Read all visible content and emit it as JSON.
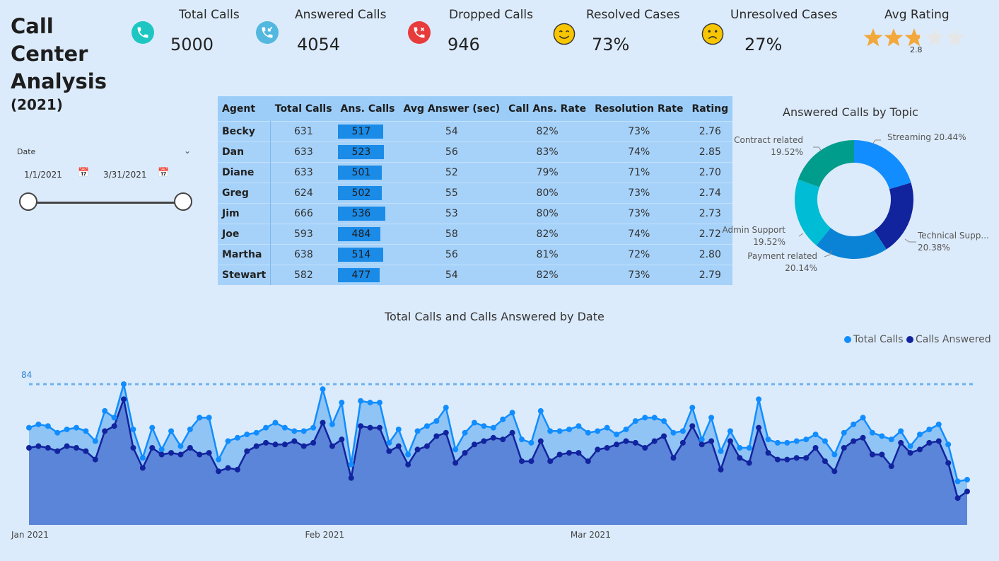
{
  "title": {
    "line1": "Call",
    "line2": "Center",
    "line3": "Analysis",
    "year": "(2021)"
  },
  "kpis": [
    {
      "label": "Total Calls",
      "value": "5000",
      "icon": "phone-icon",
      "color": "#1ec6c2"
    },
    {
      "label": "Answered Calls",
      "value": "4054",
      "icon": "incoming-call-icon",
      "color": "#52b8df"
    },
    {
      "label": "Dropped Calls",
      "value": "946",
      "icon": "missed-call-icon",
      "color": "#e83b3b"
    },
    {
      "label": "Resolved Cases",
      "value": "73%",
      "icon": "smiling-face-icon",
      "color": "#f7c600"
    },
    {
      "label": "Unresolved Cases",
      "value": "27%",
      "icon": "frowning-face-icon",
      "color": "#f7c600"
    }
  ],
  "avg_rating": {
    "label": "Avg Rating",
    "value": "2.8",
    "stars_filled": 2.8,
    "stars_total": 5,
    "star_color": "#f2a83b"
  },
  "date_slicer": {
    "label": "Date",
    "start": "1/1/2021",
    "end": "3/31/2021"
  },
  "table": {
    "headers": [
      "Agent",
      "Total Calls",
      "Ans. Calls",
      "Avg Answer (sec)",
      "Call Ans. Rate",
      "Resolution Rate",
      "Rating"
    ],
    "rows": [
      {
        "agent": "Becky",
        "total": "631",
        "answered": "517",
        "avg": "54",
        "ans_rate": "82%",
        "res_rate": "73%",
        "rating": "2.76"
      },
      {
        "agent": "Dan",
        "total": "633",
        "answered": "523",
        "avg": "56",
        "ans_rate": "83%",
        "res_rate": "74%",
        "rating": "2.85"
      },
      {
        "agent": "Diane",
        "total": "633",
        "answered": "501",
        "avg": "52",
        "ans_rate": "79%",
        "res_rate": "71%",
        "rating": "2.70"
      },
      {
        "agent": "Greg",
        "total": "624",
        "answered": "502",
        "avg": "55",
        "ans_rate": "80%",
        "res_rate": "73%",
        "rating": "2.74"
      },
      {
        "agent": "Jim",
        "total": "666",
        "answered": "536",
        "avg": "53",
        "ans_rate": "80%",
        "res_rate": "73%",
        "rating": "2.73"
      },
      {
        "agent": "Joe",
        "total": "593",
        "answered": "484",
        "avg": "58",
        "ans_rate": "82%",
        "res_rate": "74%",
        "rating": "2.72"
      },
      {
        "agent": "Martha",
        "total": "638",
        "answered": "514",
        "avg": "56",
        "ans_rate": "81%",
        "res_rate": "72%",
        "rating": "2.80"
      },
      {
        "agent": "Stewart",
        "total": "582",
        "answered": "477",
        "avg": "54",
        "ans_rate": "82%",
        "res_rate": "73%",
        "rating": "2.79"
      }
    ]
  },
  "chart_data": [
    {
      "type": "pie",
      "title": "Answered Calls by Topic",
      "donut": true,
      "slices": [
        {
          "label": "Streaming",
          "value": 20.44,
          "pct": "20.44%",
          "color": "#118dff"
        },
        {
          "label": "Technical Supp...",
          "value": 20.38,
          "pct": "20.38%",
          "color": "#12239e"
        },
        {
          "label": "Payment related",
          "value": 20.14,
          "pct": "20.14%",
          "color": "#0a82d6"
        },
        {
          "label": "Admin Support",
          "value": 19.52,
          "pct": "19.52%",
          "color": "#00bcd4"
        },
        {
          "label": "Contract related",
          "value": 19.52,
          "pct": "19.52%",
          "color": "#009c8c"
        }
      ]
    },
    {
      "type": "area",
      "title": "Total Calls and Calls Answered by Date",
      "x_tick_labels": [
        "Jan 2021",
        "Feb 2021",
        "Mar 2021"
      ],
      "reference_line": {
        "label": "84",
        "value": 84
      },
      "ylim": [
        0,
        84
      ],
      "series": [
        {
          "name": "Total Calls",
          "color": "#118dff",
          "values": [
            58,
            60,
            59,
            55,
            57,
            58,
            56,
            50,
            68,
            64,
            84,
            57,
            40,
            58,
            45,
            56,
            47,
            57,
            64,
            64,
            39,
            50,
            52,
            54,
            55,
            58,
            61,
            58,
            56,
            56,
            58,
            81,
            60,
            73,
            36,
            74,
            73,
            73,
            49,
            57,
            42,
            56,
            59,
            62,
            70,
            45,
            55,
            61,
            59,
            58,
            63,
            67,
            51,
            49,
            68,
            56,
            56,
            57,
            59,
            55,
            56,
            58,
            54,
            57,
            62,
            64,
            64,
            62,
            55,
            56,
            70,
            51,
            64,
            44,
            56,
            46,
            46,
            75,
            51,
            49,
            49,
            50,
            51,
            54,
            50,
            42,
            55,
            60,
            64,
            55,
            53,
            51,
            56,
            47,
            54,
            57,
            60,
            48,
            26,
            27
          ]
        },
        {
          "name": "Calls Answered",
          "color": "#12239e",
          "values": [
            46,
            47,
            46,
            44,
            47,
            46,
            44,
            39,
            56,
            59,
            75,
            46,
            34,
            46,
            42,
            43,
            42,
            46,
            42,
            43,
            32,
            34,
            33,
            44,
            47,
            49,
            48,
            48,
            50,
            47,
            49,
            61,
            47,
            51,
            28,
            59,
            58,
            58,
            44,
            47,
            36,
            45,
            47,
            53,
            55,
            37,
            43,
            48,
            50,
            52,
            51,
            55,
            38,
            38,
            50,
            38,
            42,
            43,
            43,
            38,
            45,
            46,
            48,
            50,
            49,
            46,
            50,
            53,
            40,
            49,
            59,
            48,
            50,
            33,
            50,
            40,
            37,
            58,
            43,
            39,
            39,
            40,
            40,
            46,
            38,
            32,
            46,
            50,
            52,
            42,
            42,
            35,
            49,
            43,
            45,
            49,
            50,
            37,
            16,
            20
          ]
        }
      ]
    }
  ],
  "legend": [
    {
      "label": "Total Calls",
      "color": "#118dff"
    },
    {
      "label": "Calls Answered",
      "color": "#12239e"
    }
  ]
}
